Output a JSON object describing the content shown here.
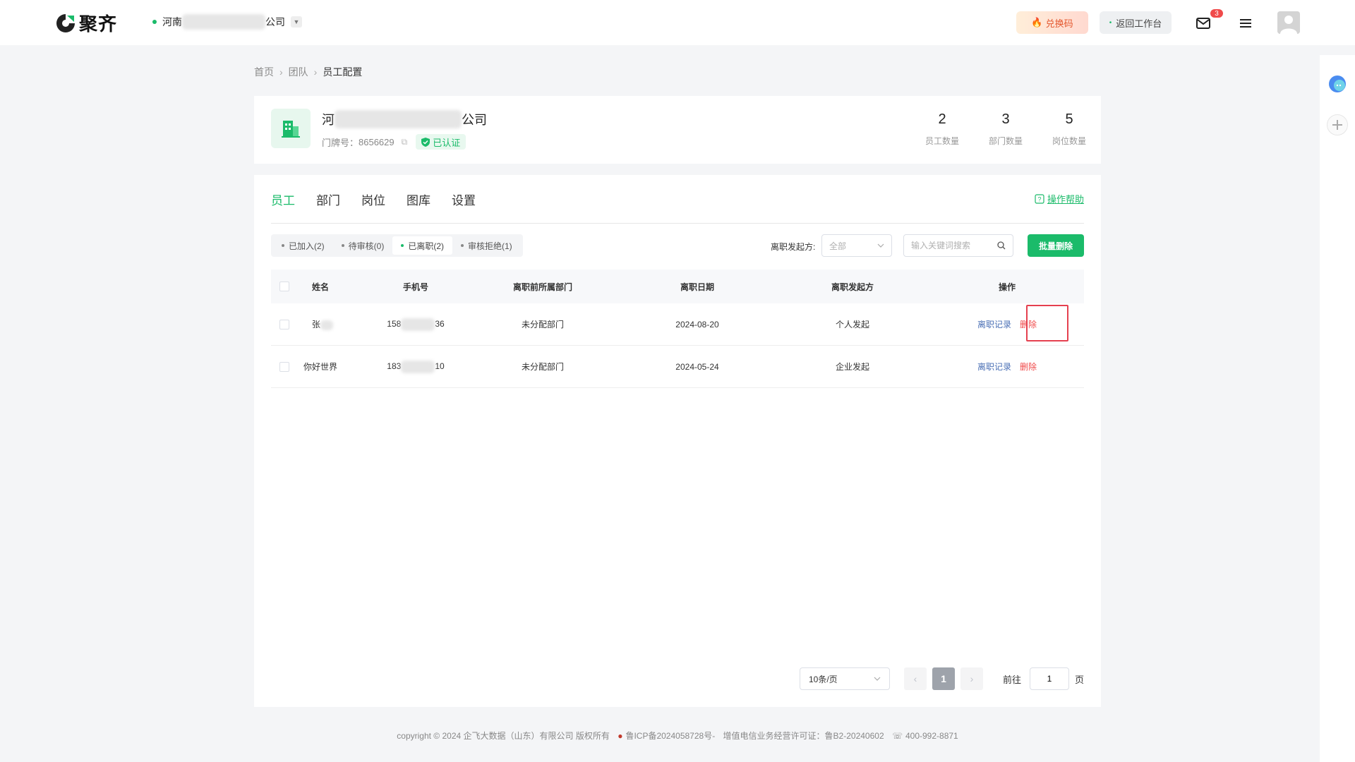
{
  "header": {
    "brand": "聚齐",
    "company_prefix": "河南",
    "company_suffix": "公司",
    "exchange_label": "兑换码",
    "back_label": "返回工作台",
    "mail_badge": "3"
  },
  "breadcrumb": {
    "home": "首页",
    "team": "团队",
    "current": "员工配置"
  },
  "company": {
    "name_prefix": "河",
    "name_suffix": "公司",
    "door_label": "门牌号：",
    "door_number": "8656629",
    "verified_label": "已认证",
    "stats": [
      {
        "value": "2",
        "label": "员工数量"
      },
      {
        "value": "3",
        "label": "部门数量"
      },
      {
        "value": "5",
        "label": "岗位数量"
      }
    ]
  },
  "tabs": [
    "员工",
    "部门",
    "岗位",
    "图库",
    "设置"
  ],
  "help_label": "操作帮助",
  "segments": [
    "已加入(2)",
    "待审核(0)",
    "已离职(2)",
    "审核拒绝(1)"
  ],
  "filter": {
    "label": "离职发起方:",
    "value": "全部",
    "search_placeholder": "输入关键词搜索",
    "batch_delete": "批量删除"
  },
  "table": {
    "headers": [
      "姓名",
      "手机号",
      "离职前所属部门",
      "离职日期",
      "离职发起方",
      "操作"
    ],
    "rows": [
      {
        "name": "张",
        "phone_prefix": "158",
        "phone_suffix": "36",
        "dept": "未分配部门",
        "date": "2024-08-20",
        "initiator": "个人发起",
        "op_record": "离职记录",
        "op_delete": "删除"
      },
      {
        "name": "你好世界",
        "phone_prefix": "183",
        "phone_suffix": "10",
        "dept": "未分配部门",
        "date": "2024-05-24",
        "initiator": "企业发起",
        "op_record": "离职记录",
        "op_delete": "删除"
      }
    ]
  },
  "pager": {
    "page_size": "10条/页",
    "current_page": "1",
    "goto_label": "前往",
    "goto_value": "1",
    "page_unit": "页"
  },
  "footer": {
    "copyright": "copyright © 2024 企飞大数据（山东）有限公司 版权所有",
    "icp": "鲁ICP备2024058728号-",
    "license": "增值电信业务经营许可证：鲁B2-20240602",
    "phone": "400-992-8871"
  },
  "colors": {
    "accent": "#1bbb6a",
    "danger": "#f04a4a",
    "link": "#4a6fb5"
  }
}
